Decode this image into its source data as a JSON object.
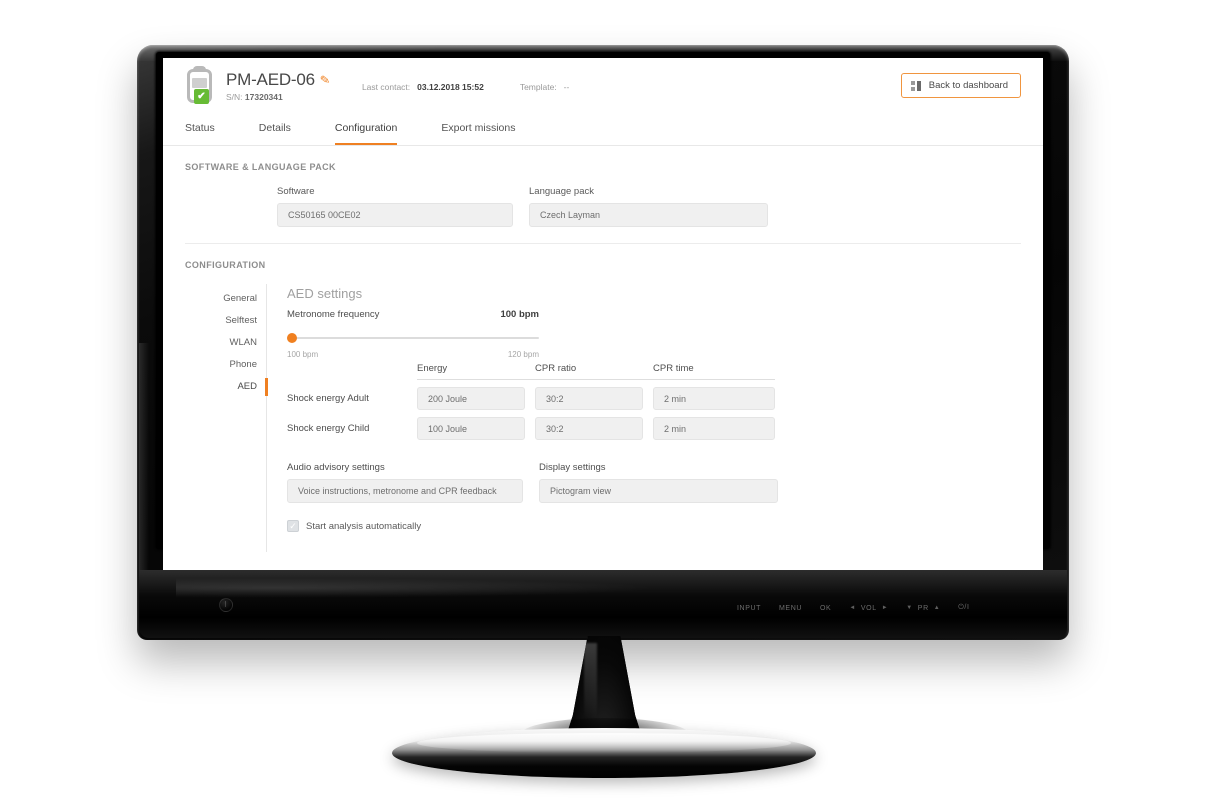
{
  "header": {
    "device_name": "PM-AED-06",
    "edit_icon": "pencil-icon",
    "serial_label": "S/N:",
    "serial_value": "17320341",
    "last_contact_label": "Last contact:",
    "last_contact_value": "03.12.2018 15:52",
    "template_label": "Template:",
    "template_value": "--",
    "back_button": "Back to dashboard",
    "status_badge": "✔",
    "accent_color": "#ef8022",
    "status_color": "#67bb35"
  },
  "tabs": [
    {
      "label": "Status",
      "active": false
    },
    {
      "label": "Details",
      "active": false
    },
    {
      "label": "Configuration",
      "active": true
    },
    {
      "label": "Export missions",
      "active": false
    }
  ],
  "software_section": {
    "title": "Software & language pack",
    "software_label": "Software",
    "software_value": "CS50165 00CE02",
    "language_label": "Language pack",
    "language_value": "Czech Layman"
  },
  "configuration_section": {
    "title": "Configuration",
    "nav": [
      {
        "label": "General",
        "active": false
      },
      {
        "label": "Selftest",
        "active": false
      },
      {
        "label": "WLAN",
        "active": false
      },
      {
        "label": "Phone",
        "active": false
      },
      {
        "label": "AED",
        "active": true
      }
    ],
    "panel_title": "AED settings",
    "metronome": {
      "label": "Metronome frequency",
      "value": "100 bpm",
      "min_label": "100 bpm",
      "max_label": "120 bpm",
      "min": 100,
      "max": 120,
      "current": 100,
      "percent": 0
    },
    "energy_table": {
      "headers": [
        "",
        "Energy",
        "CPR ratio",
        "CPR time"
      ],
      "rows": [
        {
          "label": "Shock energy Adult",
          "energy": "200 Joule",
          "ratio": "30:2",
          "time": "2 min"
        },
        {
          "label": "Shock energy Child",
          "energy": "100 Joule",
          "ratio": "30:2",
          "time": "2 min"
        }
      ]
    },
    "audio_label": "Audio advisory settings",
    "audio_value": "Voice instructions, metronome and CPR feedback",
    "display_label": "Display settings",
    "display_value": "Pictogram view",
    "auto_analysis_label": "Start analysis automatically",
    "auto_analysis_checked": true
  },
  "monitor": {
    "osd": [
      "INPUT",
      "MENU",
      "OK",
      "VOL",
      "PR",
      "⏻/I"
    ],
    "vol_left": "◄",
    "vol_right": "►",
    "pr_down": "▼",
    "pr_up": "▲"
  }
}
